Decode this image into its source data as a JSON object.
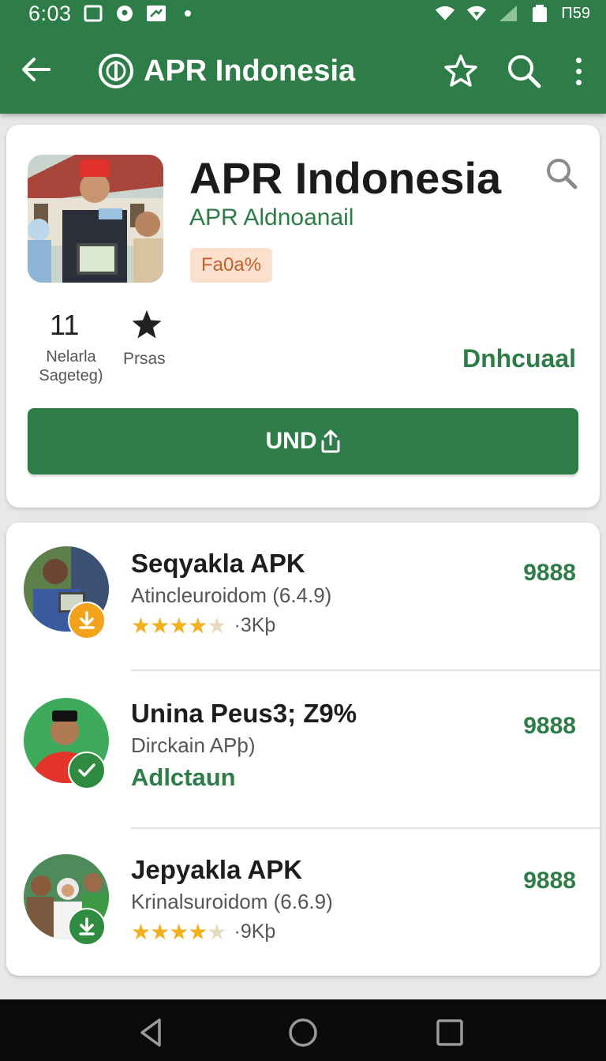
{
  "status_bar": {
    "time": "6:03",
    "battery_text": "Π59"
  },
  "app_bar": {
    "title": "APR Indonesia"
  },
  "app": {
    "title": "APR Indonesia",
    "developer": "APR Aldnoanail",
    "tag": "Fa0a%",
    "stat_number": "11",
    "stat_label": "Nelarla Sageteg)",
    "stat_label_2": "Prsas",
    "download_text": "Dnhcuaal",
    "button_label": "UND"
  },
  "list": [
    {
      "title": "Seqyakla APK",
      "subtitle": "Atincleuroidom (6.4.9)",
      "rating": 4.5,
      "size": "·3Kþ",
      "count": "9888",
      "badge": "download-icon",
      "badge_color": "#f2a21b"
    },
    {
      "title": "Unina  Peus3; Z9%",
      "subtitle": "Dirckain APþ)",
      "action": "Adlctaun",
      "count": "9888",
      "badge": "check-icon",
      "badge_color": "#2e8b3f"
    },
    {
      "title": "Jepyakla APK",
      "subtitle": "Krinalsuroidom (6.6.9)",
      "rating": 4.5,
      "size": "·9Kþ",
      "count": "9888",
      "badge": "download-icon",
      "badge_color": "#2e8b3f"
    }
  ],
  "colors": {
    "primary": "#2e7d49",
    "tag_bg": "#fbe0cd",
    "tag_text": "#c0612e",
    "star": "#f2b01e"
  }
}
